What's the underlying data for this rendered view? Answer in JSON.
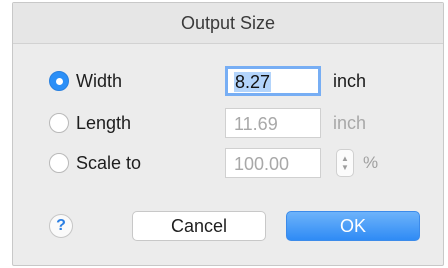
{
  "dialog": {
    "title": "Output Size"
  },
  "options": {
    "width": {
      "label": "Width",
      "value": "8.27",
      "unit": "inch",
      "selected": true
    },
    "length": {
      "label": "Length",
      "value": "11.69",
      "unit": "inch",
      "selected": false
    },
    "scale": {
      "label": "Scale to",
      "value": "100.00",
      "unit": "%",
      "selected": false
    }
  },
  "buttons": {
    "help": "?",
    "cancel": "Cancel",
    "ok": "OK"
  },
  "icons": {
    "stepper_up": "▲",
    "stepper_down": "▼"
  },
  "colors": {
    "accent": "#2b8ff7",
    "disabled_text": "#a8a8a8"
  }
}
